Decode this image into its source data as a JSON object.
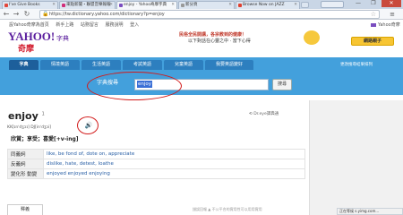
{
  "browser": {
    "tabs": [
      {
        "label": "I've Give Books",
        "fav_color": "#e2463a"
      },
      {
        "label": "來點新聞・聯盟音樂報報",
        "fav_color": "#d12e7a"
      },
      {
        "label": "enjoy - Yahoo奇摩字典",
        "fav_color": "#7a4dbf",
        "active": true
      },
      {
        "label": "新分頁",
        "fav_color": "#999999"
      },
      {
        "label": "Browse Now on JAZZ",
        "fav_color": "#e0402f"
      }
    ],
    "url": "https://tw.dictionary.yahoo.com/dictionary?p=enjoy",
    "window_buttons": [
      "—",
      "❐",
      "✕"
    ]
  },
  "yahoo": {
    "top_links": [
      "設Yahoo奇摩為首頁",
      "新手上路",
      "站務留言",
      "服務說明",
      "登入",
      "服務說明"
    ],
    "top_right": "Yahoo奇摩",
    "logo_text": "YAHOO!",
    "logo_sub": "奇摩",
    "logo_service": "字典",
    "promo_line1": "民俗全民開講，各宗教到的健康！",
    "promo_line2": "以下對話在心靈之中 · 當下心得",
    "promo_button": "網路親子"
  },
  "nav": {
    "tabs": [
      "字典",
      "情境英語",
      "生活英語",
      "考試英語",
      "兒童英語",
      "我要英語變好"
    ],
    "settings": "更改搜尋結果排列"
  },
  "search": {
    "label": "字典搜尋",
    "query": "enjoy",
    "button": "搜尋"
  },
  "entry": {
    "word": "enjoy",
    "superscript": "1",
    "source": "Dr.eye譯典通",
    "pronunciation": "KK[ɪnˈdʒɔɪ] DJ[inˈdʒɔi]",
    "definition": "欣賞；享受；喜愛[+v-ing]",
    "rows": [
      {
        "label": "同義詞",
        "value": "like, be fond of, dote on, appreciate"
      },
      {
        "label": "反義詞",
        "value": "dislike, hate, detest, loathe"
      },
      {
        "label": "變化形 動變",
        "value": "enjoyed enjoyed enjoying"
      }
    ],
    "bottom_tab": "釋義",
    "report": "錯誤回報 ▲ 不公平合的實用性可以用用實用",
    "status": "正在等候 s.yimg.com..."
  },
  "colors": {
    "brand_blue": "#43a0dc",
    "nav_active": "#1d5f9b",
    "annotation_red": "#d21a1a",
    "highlight": "#3a6fd6"
  }
}
